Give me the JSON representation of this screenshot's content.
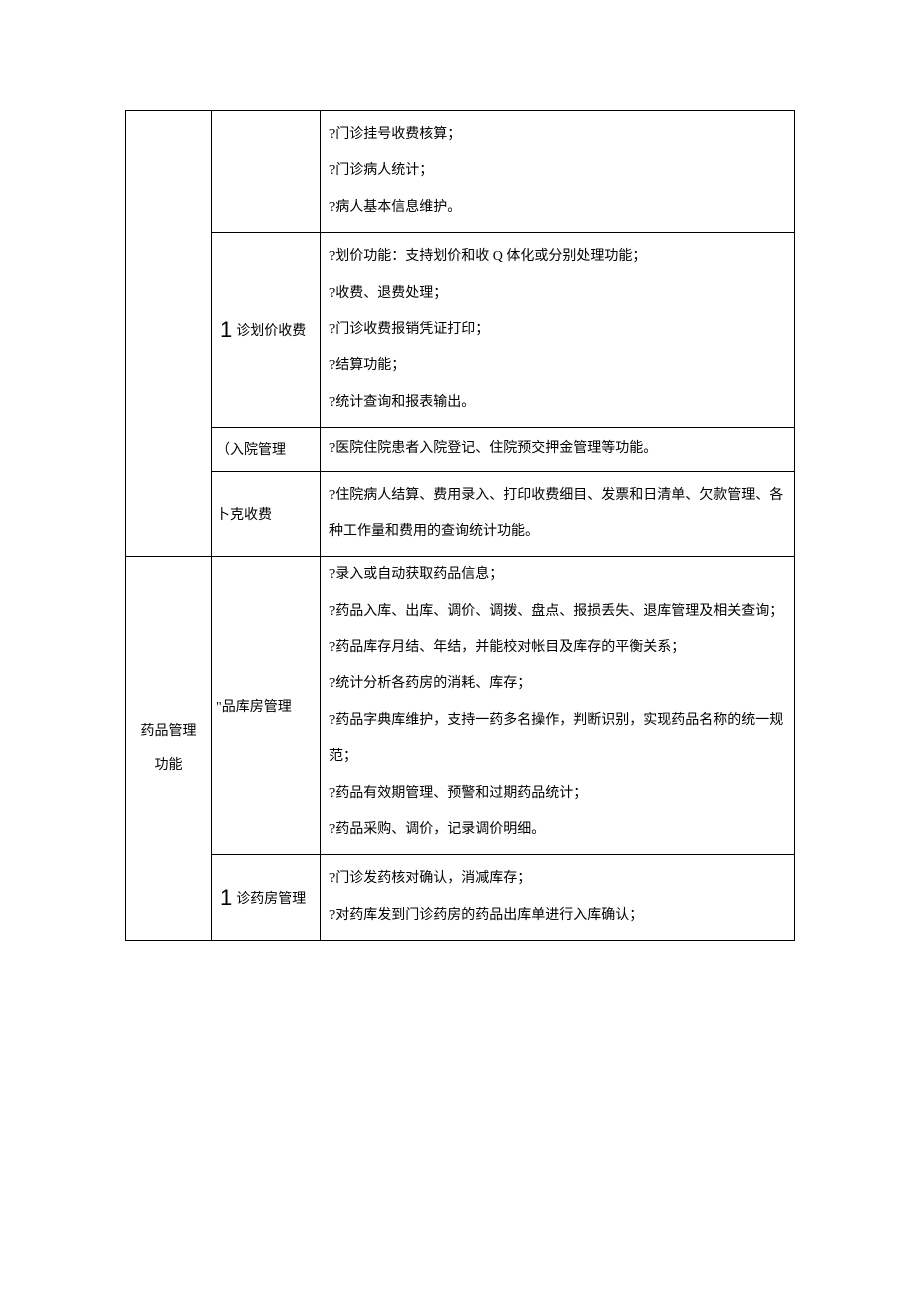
{
  "rows": [
    {
      "col1": "",
      "col2_prefix": "",
      "col2": "",
      "col3": [
        "?门诊挂号收费核算；",
        "?门诊病人统计；",
        "?病人基本信息维护。"
      ]
    },
    {
      "col2_prefix": "1",
      "col2": "诊划价收费",
      "col3": [
        "?划价功能：支持划价和收 Q 体化或分别处理功能；",
        "?收费、退费处理；",
        "?门诊收费报销凭证打印；",
        "?结算功能；",
        "?统计查询和报表输出。"
      ]
    },
    {
      "col2_prefix": "",
      "col2": "（入院管理",
      "col3": [
        "?医院住院患者入院登记、住院预交押金管理等功能。"
      ]
    },
    {
      "col2_prefix": "",
      "col2": "卜克收费",
      "col3": [
        "?住院病人结算、费用录入、打印收费细目、发票和日清单、欠款管理、各种工作量和费用的查询统计功能。"
      ]
    },
    {
      "col1_lines": [
        "药品管理",
        "功能"
      ],
      "col2_prefix": "",
      "col2": "\"品库房管理",
      "col3": [
        "?录入或自动获取药品信息；",
        "?药品入库、出库、调价、调拨、盘点、报损丢失、退库管理及相关查询；",
        "?药品库存月结、年结，并能校对帐目及库存的平衡关系；",
        "?统计分析各药房的消耗、库存；",
        "?药品字典库维护，支持一药多名操作，判断识别，实现药品名称的统一规范；",
        "?药品有效期管理、预警和过期药品统计；",
        "?药品采购、调价，记录调价明细。"
      ]
    },
    {
      "col2_prefix": "1",
      "col2": "诊药房管理",
      "col3": [
        "?门诊发药核对确认，消减库存；",
        "?对药库发到门诊药房的药品出库单进行入库确认；"
      ]
    }
  ]
}
